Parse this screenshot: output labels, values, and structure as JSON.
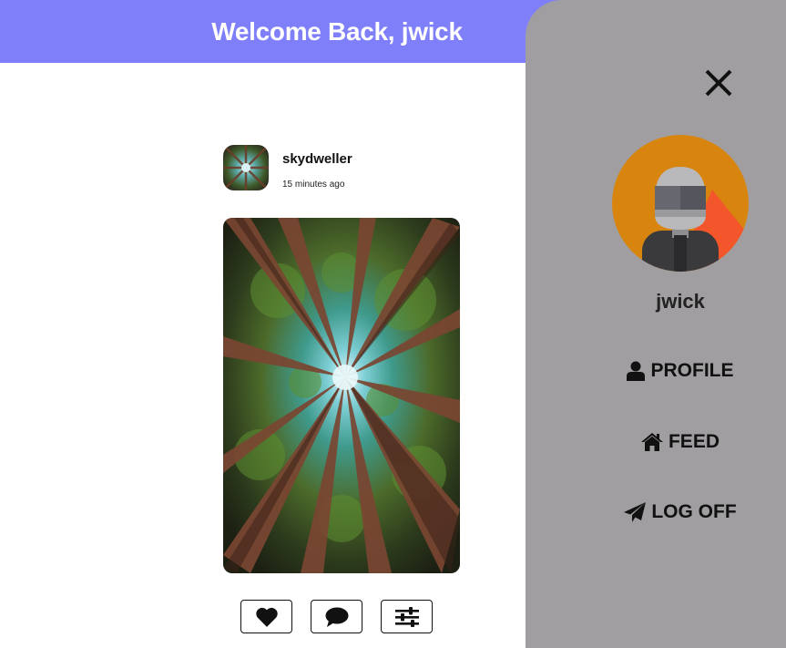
{
  "header": {
    "title": "Welcome Back, jwick",
    "background": "#7f7ff9"
  },
  "post": {
    "username": "skydweller",
    "time": "15 minutes ago",
    "image_description": "forest canopy viewed from below",
    "actions": [
      {
        "name": "like",
        "icon": "heart-icon"
      },
      {
        "name": "comment",
        "icon": "comment-icon"
      },
      {
        "name": "options",
        "icon": "sliders-icon"
      }
    ]
  },
  "drawer": {
    "background": "#a19ea1",
    "close_icon": "close-icon",
    "username": "jwick",
    "nav": [
      {
        "label": "PROFILE",
        "icon": "user-icon"
      },
      {
        "label": "FEED",
        "icon": "home-icon"
      },
      {
        "label": "LOG OFF",
        "icon": "paper-plane-icon"
      }
    ]
  }
}
